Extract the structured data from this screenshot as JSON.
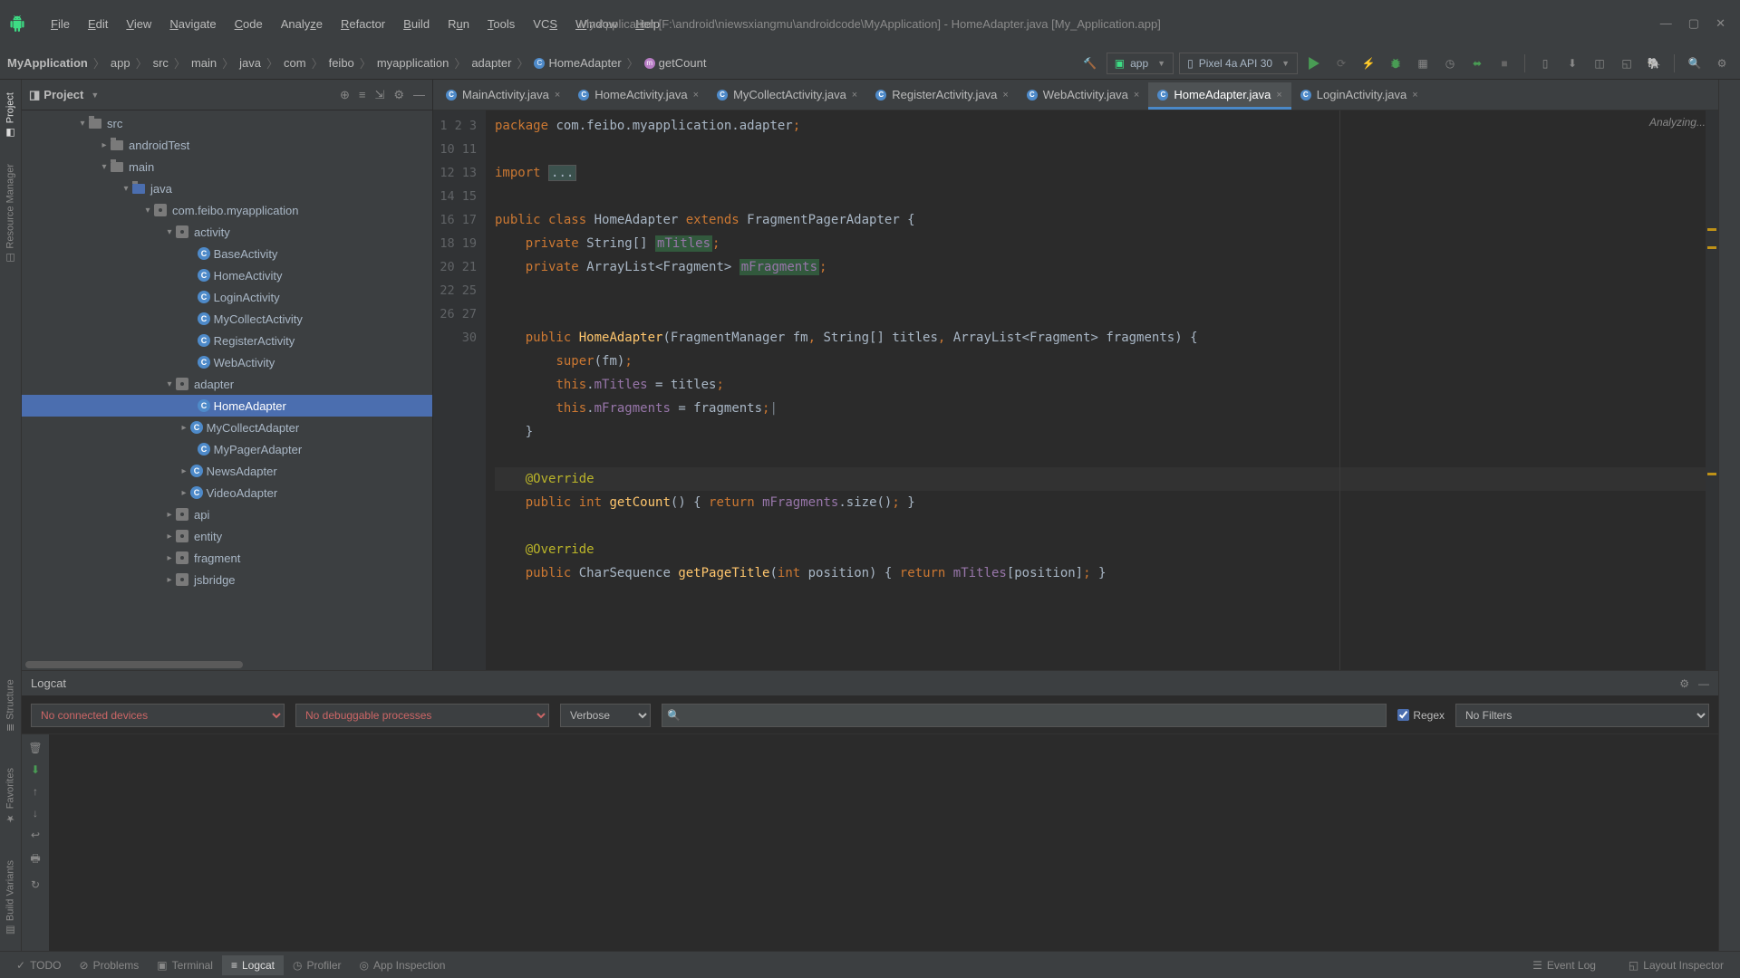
{
  "window": {
    "title": "My Application [F:\\android\\niewsxiangmu\\androidcode\\MyApplication] - HomeAdapter.java [My_Application.app]"
  },
  "menu": {
    "file": "File",
    "edit": "Edit",
    "view": "View",
    "navigate": "Navigate",
    "code": "Code",
    "analyze": "Analyze",
    "refactor": "Refactor",
    "build": "Build",
    "run": "Run",
    "tools": "Tools",
    "vcs": "VCS",
    "window": "Window",
    "help": "Help"
  },
  "breadcrumb": {
    "items": [
      "MyApplication",
      "app",
      "src",
      "main",
      "java",
      "com",
      "feibo",
      "myapplication",
      "adapter"
    ],
    "class": "HomeAdapter",
    "method": "getCount"
  },
  "toolbar": {
    "app_config": "app",
    "device": "Pixel 4a API 30"
  },
  "project_panel": {
    "title": "Project",
    "tree": {
      "src": "src",
      "androidTest": "androidTest",
      "main": "main",
      "java": "java",
      "pkg": "com.feibo.myapplication",
      "activity": "activity",
      "activities": [
        "BaseActivity",
        "HomeActivity",
        "LoginActivity",
        "MyCollectActivity",
        "RegisterActivity",
        "WebActivity"
      ],
      "adapter": "adapter",
      "adapters": [
        "HomeAdapter",
        "MyCollectAdapter",
        "MyPagerAdapter",
        "NewsAdapter",
        "VideoAdapter"
      ],
      "api": "api",
      "entity": "entity",
      "fragment": "fragment",
      "jsbridge": "jsbridge"
    }
  },
  "editor": {
    "tabs": [
      "MainActivity.java",
      "HomeActivity.java",
      "MyCollectActivity.java",
      "RegisterActivity.java",
      "WebActivity.java",
      "HomeAdapter.java",
      "LoginActivity.java"
    ],
    "active_tab": "HomeAdapter.java",
    "status": "Analyzing...",
    "code": {
      "l1": "package com.feibo.myapplication.adapter;",
      "l3a": "import ",
      "l3b": "...",
      "l10": "public class HomeAdapter extends FragmentPagerAdapter {",
      "l11": "    private String[] mTitles;",
      "l12": "    private ArrayList<Fragment> mFragments;",
      "l15": "    public HomeAdapter(FragmentManager fm, String[] titles, ArrayList<Fragment> fragments) {",
      "l16": "        super(fm);",
      "l17": "        this.mTitles = titles;",
      "l18": "        this.mFragments = fragments;",
      "l19": "    }",
      "l21": "    @Override",
      "l22": "    public int getCount() { return mFragments.size(); }",
      "l26": "    @Override",
      "l27": "    public CharSequence getPageTitle(int position) { return mTitles[position]; }"
    },
    "line_numbers": [
      "1",
      "2",
      "3",
      "",
      "10",
      "11",
      "12",
      "13",
      "14",
      "15",
      "16",
      "17",
      "18",
      "19",
      "20",
      "21",
      "22",
      "25",
      "26",
      "27",
      "30",
      ""
    ]
  },
  "logcat": {
    "title": "Logcat",
    "devices": "No connected devices",
    "processes": "No debuggable processes",
    "level": "Verbose",
    "regex_label": "Regex",
    "filter": "No Filters",
    "search_placeholder": ""
  },
  "bottom_tabs": {
    "todo": "TODO",
    "problems": "Problems",
    "terminal": "Terminal",
    "logcat": "Logcat",
    "profiler": "Profiler",
    "app_inspection": "App Inspection",
    "event_log": "Event Log",
    "layout_inspector": "Layout Inspector"
  },
  "left_gutter": {
    "project": "Project",
    "resource_manager": "Resource Manager"
  },
  "right_gutter": {
    "device_file": "",
    "emulator": ""
  },
  "left_bottom_gutter": {
    "structure": "Structure",
    "favorites": "Favorites",
    "build_variants": "Build Variants"
  }
}
